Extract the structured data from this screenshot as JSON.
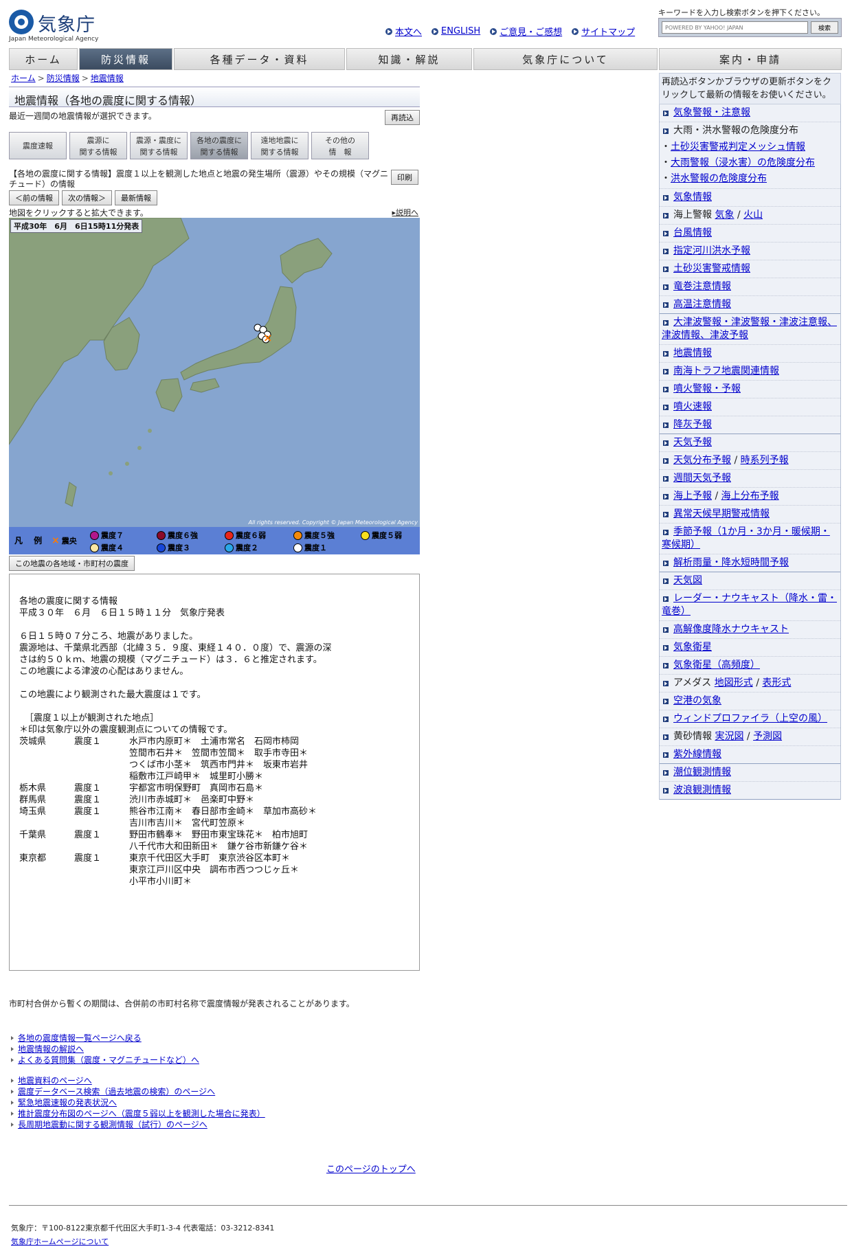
{
  "header": {
    "logo_jp": "気象庁",
    "logo_en": "Japan Meteorological Agency",
    "links": [
      "本文へ",
      "ENGLISH",
      "ご意見・ご感想",
      "サイトマップ"
    ],
    "search_hint": "キーワードを入力し検索ボタンを押下ください。",
    "search_placeholder": "POWERED BY YAHOO! JAPAN",
    "search_button": "検索"
  },
  "nav": {
    "items": [
      "ホーム",
      "防災情報",
      "各種データ・資料",
      "知識・解説",
      "気象庁について",
      "案内・申請"
    ]
  },
  "breadcrumb": [
    "ホーム",
    "防災情報",
    "地震情報"
  ],
  "page": {
    "title": "地震情報（各地の震度に関する情報）",
    "subtitle": "最近一週間の地震情報が選択できます。",
    "reload": "再読込",
    "tabs": [
      {
        "l1": "震度速報",
        "l2": ""
      },
      {
        "l1": "震源に",
        "l2": "関する情報"
      },
      {
        "l1": "震源・震度に",
        "l2": "関する情報"
      },
      {
        "l1": "各地の震度に",
        "l2": "関する情報"
      },
      {
        "l1": "遠地地震に",
        "l2": "関する情報"
      },
      {
        "l1": "その他の",
        "l2": "情　報"
      }
    ],
    "description": "【各地の震度に関する情報】震度１以上を観測した地点と地震の発生場所（震源）やその規模（マグニチュード）の情報",
    "print": "印刷",
    "prev": "＜前の情報",
    "next": "次の情報＞",
    "latest": "最新情報",
    "map_hint": "地図をクリックすると拡大できます。",
    "explain": "説明へ",
    "map_stamp": "平成30年　6月　6日15時11分発表",
    "copyright": "All rights reserved. Copyright © Japan Meteorological Agency",
    "legend": {
      "title": "凡 例",
      "epicenter": "震央",
      "items": [
        {
          "label": "震度７",
          "color": "#b2178b"
        },
        {
          "label": "震度６強",
          "color": "#8b0a2a"
        },
        {
          "label": "震度６弱",
          "color": "#e8251a"
        },
        {
          "label": "震度５強",
          "color": "#f38a0b"
        },
        {
          "label": "震度５弱",
          "color": "#f7df1e"
        },
        {
          "label": "震度４",
          "color": "#fbe7a4"
        },
        {
          "label": "震度３",
          "color": "#1746d8"
        },
        {
          "label": "震度２",
          "color": "#2aa7e8"
        },
        {
          "label": "震度１",
          "color": "#ffffff"
        }
      ]
    },
    "region_button": "この地震の各地域・市町村の震度"
  },
  "report": {
    "heading": "各地の震度に関する情報",
    "issued": "平成３０年　６月　６日１５時１１分　気象庁発表",
    "body1": "６日１５時０７分ころ、地震がありました。",
    "body2": "震源地は、千葉県北西部（北緯３５．９度、東経１４０．０度）で、震源の深",
    "body3": "さは約５０ｋｍ、地震の規模（マグニチュード）は３．６と推定されます。",
    "body4": "この地震による津波の心配はありません。",
    "body5": "この地震により観測された最大震度は１です。",
    "list_heading": "［震度１以上が観測された地点］",
    "list_note": "＊印は気象庁以外の震度観測点についての情報です。",
    "rows": [
      {
        "pref": "茨城県",
        "level": "震度１",
        "places": [
          "水戸市内原町＊　土浦市常名　石岡市柿岡",
          "笠間市石井＊　笠間市笠間＊　取手市寺田＊",
          "つくば市小茎＊　筑西市門井＊　坂東市岩井",
          "稲敷市江戸崎甲＊　城里町小勝＊"
        ]
      },
      {
        "pref": "栃木県",
        "level": "震度１",
        "places": [
          "宇都宮市明保野町　真岡市石島＊"
        ]
      },
      {
        "pref": "群馬県",
        "level": "震度１",
        "places": [
          "渋川市赤城町＊　邑楽町中野＊"
        ]
      },
      {
        "pref": "埼玉県",
        "level": "震度１",
        "places": [
          "熊谷市江南＊　春日部市金崎＊　草加市高砂＊",
          "吉川市吉川＊　宮代町笠原＊"
        ]
      },
      {
        "pref": "千葉県",
        "level": "震度１",
        "places": [
          "野田市鶴奉＊　野田市東宝珠花＊　柏市旭町",
          "八千代市大和田新田＊　鎌ケ谷市新鎌ケ谷＊"
        ]
      },
      {
        "pref": "東京都",
        "level": "震度１",
        "places": [
          "東京千代田区大手町　東京渋谷区本町＊",
          "東京江戸川区中央　調布市西つつじヶ丘＊",
          "小平市小川町＊"
        ]
      }
    ]
  },
  "note": "市町村合併から暫くの期間は、合併前の市町村名称で震度情報が発表されることがあります。",
  "links_group1": [
    "各地の震度情報一覧ページへ戻る",
    "地震情報の解説へ",
    "よくある質問集（震度・マグニチュードなど）へ"
  ],
  "links_group2": [
    "地震資料のページへ",
    "震度データベース検索（過去地震の検索）のページへ",
    "緊急地震速報の発表状況へ",
    "推計震度分布図のページへ（震度５弱以上を観測した場合に発表）",
    "長周期地震動に関する観測情報（試行）のページへ"
  ],
  "pagetop": "このページのトップへ",
  "footer": {
    "address": "気象庁：〒100-8122東京都千代田区大手町1-3-4 代表電話：03-3212-8341",
    "about": "気象庁ホームページについて"
  },
  "sidebar": {
    "note": "再読込ボタンかブラウザの更新ボタンをクリックして最新の情報をお使いください。",
    "g1": {
      "warnings": "気象警報・注意報",
      "risk": "大雨・洪水警報の危険度分布",
      "sub1": "土砂災害警戒判定メッシュ情報",
      "sub2": "大雨警報（浸水害）の危険度分布",
      "sub3": "洪水警報の危険度分布",
      "weather_info": "気象情報",
      "marine_prefix": "海上警報",
      "marine_a": "気象",
      "marine_b": "火山",
      "typhoon": "台風情報",
      "river": "指定河川洪水予報",
      "landslide": "土砂災害警戒情報",
      "tornado": "竜巻注意情報",
      "heat": "高温注意情報"
    },
    "g2": {
      "tsunami": "大津波警報・津波警報・津波注意報、津波情報、津波予報",
      "quake": "地震情報",
      "nankai": "南海トラフ地震関連情報",
      "volcano_warn": "噴火警報・予報",
      "volcano_quick": "噴火速報",
      "ash": "降灰予報"
    },
    "g3": {
      "forecast": "天気予報",
      "dist_a": "天気分布予報",
      "dist_b": "時系列予報",
      "weekly": "週間天気予報",
      "sea_a": "海上予報",
      "sea_b": "海上分布予報",
      "early": "異常天候早期警戒情報",
      "season": "季節予報（1か月・3か月・暖候期・寒候期）",
      "rain": "解析雨量・降水短時間予報"
    },
    "g4": {
      "chart": "天気図",
      "radar": "レーダー・ナウキャスト（降水・雷・竜巻）",
      "hires": "高解像度降水ナウキャスト",
      "sat": "気象衛星",
      "sat_hf": "気象衛星（高頻度）",
      "amedas_prefix": "アメダス",
      "amedas_a": "地図形式",
      "amedas_b": "表形式",
      "airport": "空港の気象",
      "profiler": "ウィンドプロファイラ（上空の風）",
      "dust_prefix": "黄砂情報",
      "dust_a": "実況図",
      "dust_b": "予測図",
      "uv": "紫外線情報",
      "tide": "潮位観測情報",
      "wave": "波浪観測情報"
    }
  }
}
